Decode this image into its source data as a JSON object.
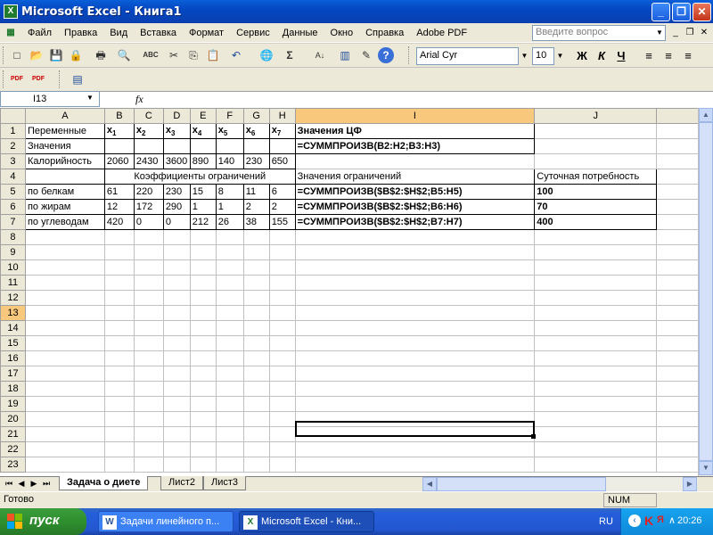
{
  "window": {
    "title": "Microsoft Excel - Книга1",
    "app_icon": "X",
    "buttons": {
      "minimize": "_",
      "maximize": "❐",
      "close": "✕"
    }
  },
  "menu": {
    "items": [
      "Файл",
      "Правка",
      "Вид",
      "Вставка",
      "Формат",
      "Сервис",
      "Данные",
      "Окно",
      "Справка",
      "Adobe PDF"
    ],
    "help_placeholder": "Введите вопрос",
    "mdi_buttons": {
      "minimize": "_",
      "restore": "❐",
      "close": "✕"
    }
  },
  "toolbar": {
    "font_name": "Arial Cyr",
    "font_size": "10",
    "bold": "Ж",
    "italic": "К",
    "underline": "Ч",
    "icons": {
      "new": "□",
      "open": "📂",
      "save": "💾",
      "permission": "🔒",
      "print": "🖶",
      "preview": "🔍",
      "spell": "ABC",
      "cut": "✂",
      "copy": "⎘",
      "paste": "📋",
      "undo": "↶",
      "hyperlink": "🌐",
      "autosum": "Σ",
      "sort": "A↓",
      "chart": "▥",
      "drawing": "✎",
      "help": "?",
      "align_left": "≡",
      "align_center": "≡",
      "align_right": "≡"
    }
  },
  "toolbar2": {
    "pdf1": "PDF",
    "pdf2": "PDF",
    "review": "▤"
  },
  "formula_bar": {
    "name_box": "I13",
    "fx": "fx",
    "content": ""
  },
  "sheet": {
    "columns": [
      "A",
      "B",
      "C",
      "D",
      "E",
      "F",
      "G",
      "H",
      "I",
      "J"
    ],
    "rows": [
      "1",
      "2",
      "3",
      "4",
      "5",
      "6",
      "7",
      "8",
      "9",
      "10",
      "11",
      "12",
      "13",
      "14",
      "15",
      "16",
      "17",
      "18",
      "19",
      "20",
      "21",
      "22",
      "23"
    ],
    "selected_row": "13",
    "selected_col": "I",
    "cells": {
      "A1": "Переменные",
      "B1": "x",
      "B1s": "1",
      "C1": "x",
      "C1s": "2",
      "D1": "x",
      "D1s": "3",
      "E1": "x",
      "E1s": "4",
      "F1": "x",
      "F1s": "5",
      "G1": "x",
      "G1s": "6",
      "H1": "x",
      "H1s": "7",
      "I1": "Значения ЦФ",
      "A2": "Значения",
      "I2": "=СУММПРОИЗВ(B2:H2;B3:H3)",
      "A3": "Калорийность",
      "B3": "2060",
      "C3": "2430",
      "D3": "3600",
      "E3": "890",
      "F3": "140",
      "G3": "230",
      "H3": "650",
      "B4": "Коэффициенты ограничений",
      "I4": "Значения ограничений",
      "J4": "Суточная потребность",
      "A5": "по белкам",
      "B5": "61",
      "C5": "220",
      "D5": "230",
      "E5": "15",
      "F5": "8",
      "G5": "11",
      "H5": "6",
      "I5": "=СУММПРОИЗВ($B$2:$H$2;B5:H5)",
      "J5": "100",
      "A6": "по жирам",
      "B6": "12",
      "C6": "172",
      "D6": "290",
      "E6": "1",
      "F6": "1",
      "G6": "2",
      "H6": "2",
      "I6": "=СУММПРОИЗВ($B$2:$H$2;B6:H6)",
      "J6": "70",
      "A7": "по углеводам",
      "B7": "420",
      "C7": "0",
      "D7": "0",
      "E7": "212",
      "F7": "26",
      "G7": "38",
      "H7": "155",
      "I7": "=СУММПРОИЗВ($B$2:$H$2;B7:H7)",
      "J7": "400"
    }
  },
  "tabs": {
    "nav": [
      "⏮",
      "◀",
      "▶",
      "⏭"
    ],
    "sheets": [
      "Задача о диете",
      "Лист2",
      "Лист3"
    ],
    "active": "Задача о диете"
  },
  "status": {
    "ready": "Готово",
    "num": "NUM"
  },
  "taskbar": {
    "start": "пуск",
    "items": [
      {
        "label": "Задачи линейного п...",
        "icon": "W"
      },
      {
        "label": "Microsoft Excel - Кни...",
        "icon": "X"
      }
    ],
    "lang": "RU",
    "clock": "20:26"
  },
  "colors": {
    "title_blue": "#0a5fd8",
    "selected_header": "#f8c87c",
    "taskbar_blue": "#245edb",
    "start_green": "#2f8f2f"
  }
}
